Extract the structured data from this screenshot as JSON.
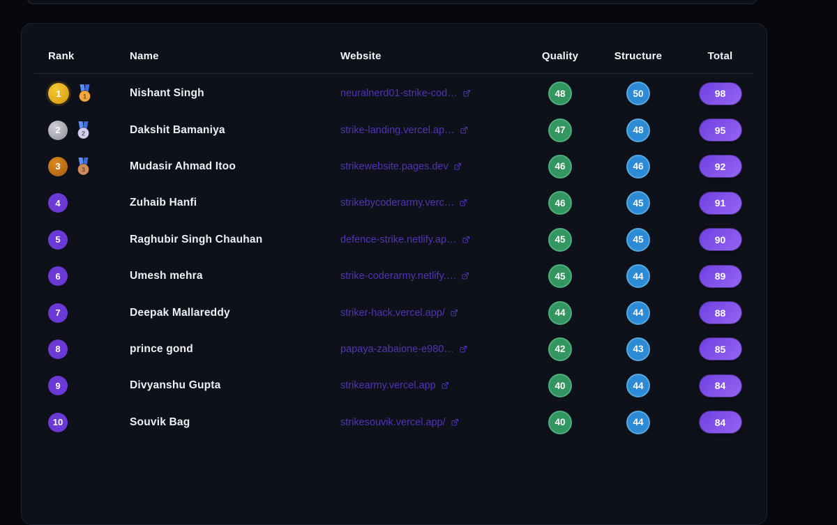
{
  "colors": {
    "page_bg": "#07080c",
    "link": "#4e35b5",
    "quality_badge": "#33955f",
    "quality_ring": "#4fae7d",
    "structure_badge": "#2c8bd4",
    "structure_ring": "#55a9e0",
    "total_gradient_start": "#7040e2",
    "total_gradient_end": "#9565f2",
    "rank_gold_start": "#f6c733",
    "rank_gold_end": "#d5990e",
    "rank_silver_start": "#cdcdd6",
    "rank_silver_end": "#8f8f98",
    "rank_bronze_start": "#dd8a1e",
    "rank_bronze_end": "#a25a0c",
    "rank_default": "#6b3ad6",
    "medal_ribbon_left": "#5c8ff0",
    "medal_ribbon_right": "#3c6cd8",
    "medal_gold": "#f2a83c",
    "medal_silver": "#d5cdee",
    "medal_bronze": "#d08c5c"
  },
  "table": {
    "columns": [
      {
        "key": "rank",
        "label": "Rank",
        "align": "left"
      },
      {
        "key": "name",
        "label": "Name",
        "align": "left"
      },
      {
        "key": "website",
        "label": "Website",
        "align": "left"
      },
      {
        "key": "quality",
        "label": "Quality",
        "align": "center"
      },
      {
        "key": "structure",
        "label": "Structure",
        "align": "center"
      },
      {
        "key": "total",
        "label": "Total",
        "align": "center"
      }
    ],
    "rows": [
      {
        "rank": "1",
        "medal": "gold",
        "name": "Nishant Singh",
        "website": "neuralnerd01-strike-cod…",
        "quality": "48",
        "structure": "50",
        "total": "98"
      },
      {
        "rank": "2",
        "medal": "silver",
        "name": "Dakshit Bamaniya",
        "website": "strike-landing.vercel.ap…",
        "quality": "47",
        "structure": "48",
        "total": "95"
      },
      {
        "rank": "3",
        "medal": "bronze",
        "name": "Mudasir Ahmad Itoo",
        "website": "strikewebsite.pages.dev",
        "quality": "46",
        "structure": "46",
        "total": "92"
      },
      {
        "rank": "4",
        "medal": "",
        "name": "Zuhaib Hanfi",
        "website": "strikebycoderarmy.verc…",
        "quality": "46",
        "structure": "45",
        "total": "91"
      },
      {
        "rank": "5",
        "medal": "",
        "name": "Raghubir Singh Chauhan",
        "website": "defence-strike.netlify.ap…",
        "quality": "45",
        "structure": "45",
        "total": "90"
      },
      {
        "rank": "6",
        "medal": "",
        "name": "Umesh mehra",
        "website": "strike-coderarmy.netlify.…",
        "quality": "45",
        "structure": "44",
        "total": "89"
      },
      {
        "rank": "7",
        "medal": "",
        "name": "Deepak Mallareddy",
        "website": "striker-hack.vercel.app/",
        "quality": "44",
        "structure": "44",
        "total": "88"
      },
      {
        "rank": "8",
        "medal": "",
        "name": "prince gond",
        "website": "papaya-zabaione-e980…",
        "quality": "42",
        "structure": "43",
        "total": "85"
      },
      {
        "rank": "9",
        "medal": "",
        "name": "Divyanshu Gupta",
        "website": "strikearmy.vercel.app",
        "quality": "40",
        "structure": "44",
        "total": "84"
      },
      {
        "rank": "10",
        "medal": "",
        "name": "Souvik Bag",
        "website": "strikesouvik.vercel.app/",
        "quality": "40",
        "structure": "44",
        "total": "84"
      }
    ]
  }
}
